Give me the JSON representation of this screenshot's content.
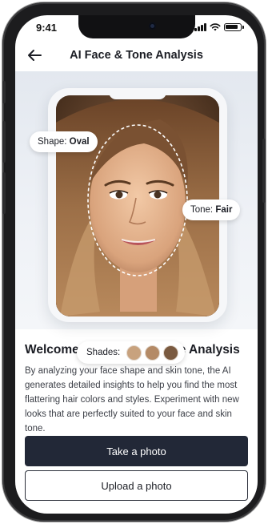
{
  "status_bar": {
    "time": "9:41"
  },
  "nav": {
    "title": "AI Face & Tone Analysis",
    "back_icon": "arrow-left-icon"
  },
  "analysis": {
    "shape": {
      "label": "Shape:",
      "value": "Oval"
    },
    "tone": {
      "label": "Tone:",
      "value": "Fair"
    },
    "shades": {
      "label": "Shades:",
      "colors": [
        "#c8a27e",
        "#b48a66",
        "#7a5a40"
      ]
    }
  },
  "content": {
    "heading": "Welcome to AI Face & Tone Analysis",
    "description": "By analyzing your face shape and skin tone, the AI generates detailed insights to help you find the most flattering hair colors and styles. Experiment with new looks that are perfectly suited to your face and skin tone."
  },
  "actions": {
    "take_photo": "Take a photo",
    "upload_photo": "Upload a photo"
  },
  "colors": {
    "primary_button": "#222837",
    "text": "#1b1d24"
  }
}
